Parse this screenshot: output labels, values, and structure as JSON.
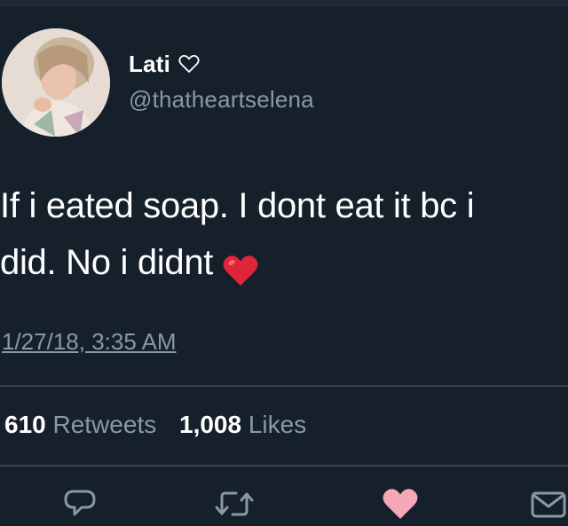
{
  "tweet": {
    "display_name": "Lati",
    "handle": "@thatheartselena",
    "text_line1": "If i eated soap. I dont eat it bc i",
    "text_line2": "did. No i didnt",
    "timestamp": "1/27/18, 3:35 AM",
    "retweets_count": "610",
    "retweets_label": "Retweets",
    "likes_count": "1,008",
    "likes_label": "Likes"
  },
  "icons": {
    "name_suffix": "heart-outline-icon",
    "emoji": "red-heart-emoji",
    "actions": [
      "reply-icon",
      "retweet-icon",
      "like-icon",
      "direct-message-icon"
    ]
  },
  "colors": {
    "background": "#15202b",
    "secondary_text": "#8899a6",
    "divider": "#38444d",
    "like_heart": "#f5a9b8",
    "emoji_red": "#e0243a"
  }
}
